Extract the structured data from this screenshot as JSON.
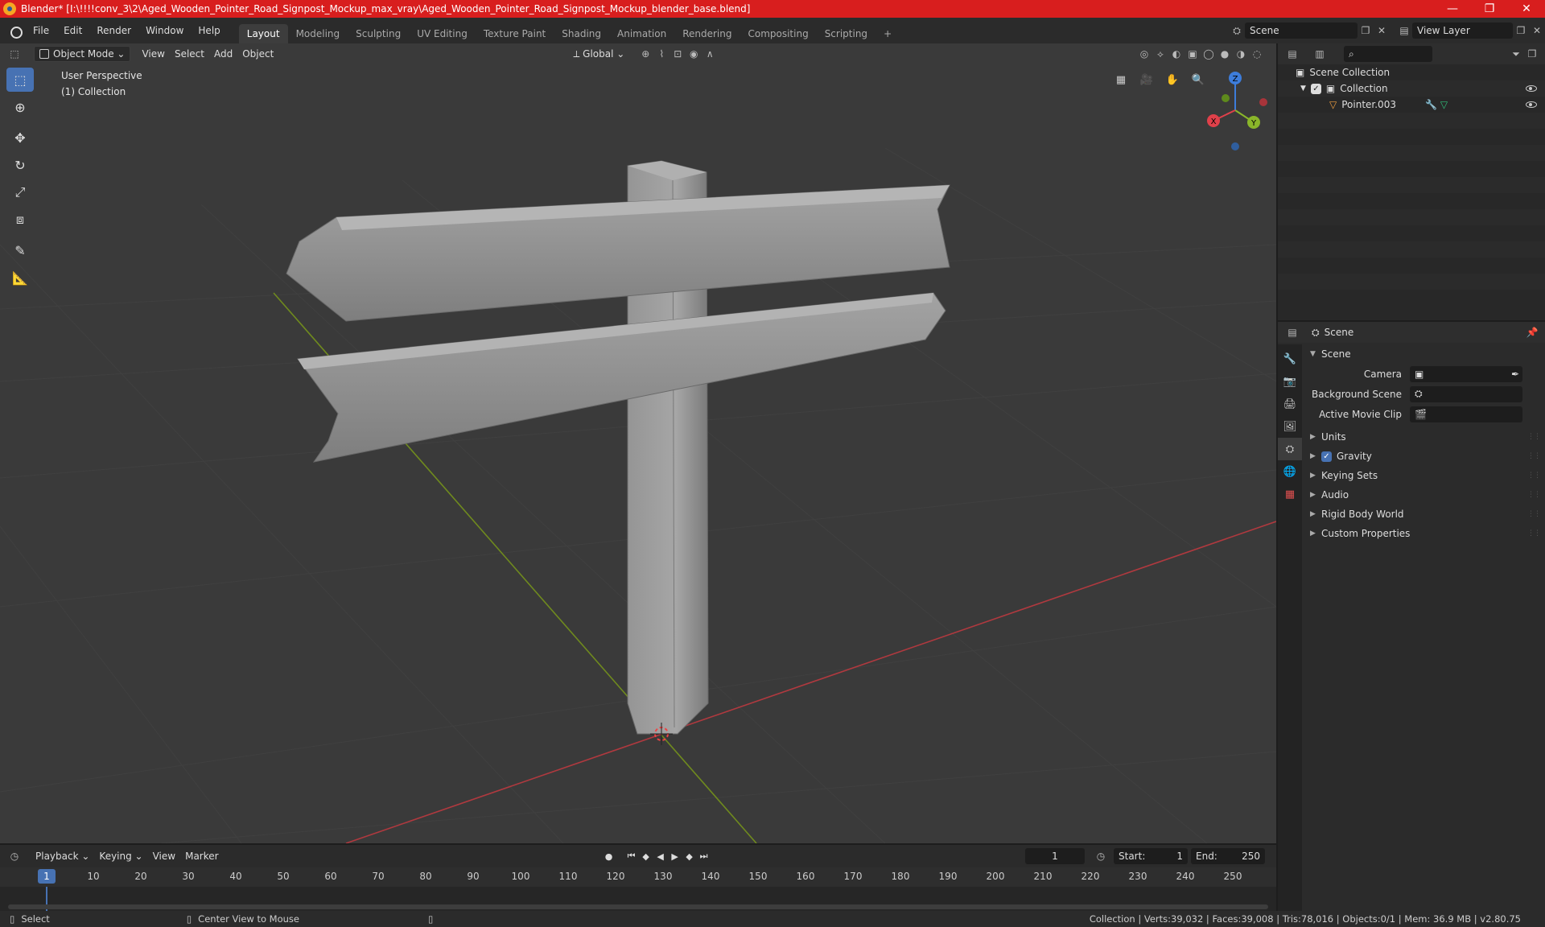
{
  "window": {
    "title": "Blender* [I:\\!!!!conv_3\\2\\Aged_Wooden_Pointer_Road_Signpost_Mockup_max_vray\\Aged_Wooden_Pointer_Road_Signpost_Mockup_blender_base.blend]",
    "min": "—",
    "max": "❐",
    "close": "✕"
  },
  "menu": {
    "items": [
      "File",
      "Edit",
      "Render",
      "Window",
      "Help"
    ],
    "workspaces": [
      "Layout",
      "Modeling",
      "Sculpting",
      "UV Editing",
      "Texture Paint",
      "Shading",
      "Animation",
      "Rendering",
      "Compositing",
      "Scripting"
    ],
    "add_tab": "+",
    "scene_value": "Scene",
    "view_layer_value": "View Layer"
  },
  "viewport": {
    "mode": "Object Mode",
    "menus": [
      "View",
      "Select",
      "Add",
      "Object"
    ],
    "transform_orientation": "Global",
    "info_line1": "User Perspective",
    "info_line2": "(1) Collection",
    "gizmo": {
      "z": "Z",
      "y": "Y",
      "x": "X"
    }
  },
  "outliner": {
    "search_placeholder": "",
    "scene_collection": "Scene Collection",
    "collection": "Collection",
    "object": "Pointer.003"
  },
  "properties": {
    "header": "Scene",
    "section": "Scene",
    "camera_label": "Camera",
    "background_scene_label": "Background Scene",
    "active_movie_clip_label": "Active Movie Clip",
    "panels": [
      "Units",
      "Gravity",
      "Keying Sets",
      "Audio",
      "Rigid Body World",
      "Custom Properties"
    ]
  },
  "timeline": {
    "menus": [
      "Playback",
      "Keying",
      "View",
      "Marker"
    ],
    "current_frame": "1",
    "start_label": "Start:",
    "start_value": "1",
    "end_label": "End:",
    "end_value": "250",
    "ruler": [
      "1",
      "10",
      "20",
      "30",
      "40",
      "50",
      "60",
      "70",
      "80",
      "90",
      "100",
      "110",
      "120",
      "130",
      "140",
      "150",
      "160",
      "170",
      "180",
      "190",
      "200",
      "210",
      "220",
      "230",
      "240",
      "250"
    ]
  },
  "status": {
    "select": "Select",
    "center_view": "Center View to Mouse",
    "stats": "Collection | Verts:39,032 | Faces:39,008 | Tris:78,016 | Objects:0/1 | Mem: 36.9 MB | v2.80.75"
  },
  "colors": {
    "accent": "#4772b3",
    "titlebar": "#d81e1e",
    "x_axis": "#e0404a",
    "y_axis": "#8ab62a",
    "z_axis": "#3d7ddb"
  }
}
